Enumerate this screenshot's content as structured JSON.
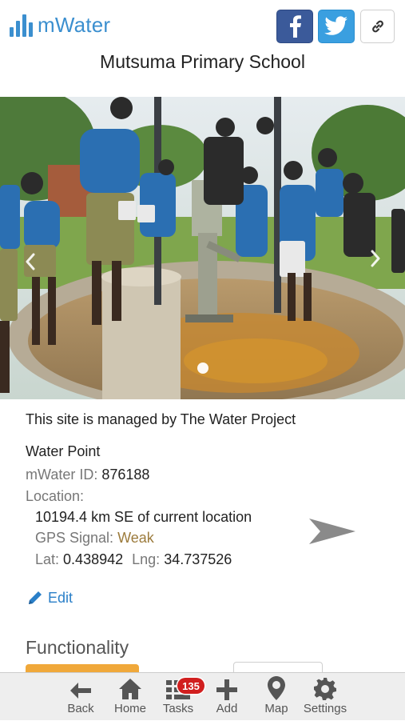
{
  "header": {
    "logo_text": "mWater",
    "share_buttons": [
      {
        "name": "facebook",
        "icon": "facebook-icon"
      },
      {
        "name": "twitter",
        "icon": "twitter-icon"
      },
      {
        "name": "link",
        "icon": "link-icon"
      }
    ],
    "title": "Mutsuma Primary School"
  },
  "photo": {
    "carousel": {
      "prev_icon": "chevron-left-icon",
      "next_icon": "chevron-right-icon",
      "pages": 1,
      "current": 1
    }
  },
  "details": {
    "managed_by": "This site is managed by The Water Project",
    "type": "Water Point",
    "id_label": "mWater ID:",
    "id_value": "876188",
    "location_label": "Location:",
    "distance": "10194.4 km SE of current location",
    "gps_label": "GPS Signal:",
    "gps_value": "Weak",
    "lat_label": "Lat:",
    "lat_value": "0.438942",
    "lng_label": "Lng:",
    "lng_value": "34.737526",
    "edit_label": "Edit",
    "direction_icon": "direction-arrow-icon"
  },
  "functionality": {
    "title": "Functionality"
  },
  "tabbar": {
    "tabs": [
      {
        "label": "Back",
        "icon": "back-arrow-icon"
      },
      {
        "label": "Home",
        "icon": "home-icon"
      },
      {
        "label": "Tasks",
        "icon": "tasks-icon",
        "badge": "135"
      },
      {
        "label": "Add",
        "icon": "plus-icon"
      },
      {
        "label": "Map",
        "icon": "map-pin-icon"
      },
      {
        "label": "Settings",
        "icon": "gear-icon"
      }
    ]
  },
  "colors": {
    "brand": "#3b8fcf",
    "facebook": "#3b5a9a",
    "twitter": "#3a9fe0",
    "link": "#2a7fc8",
    "badge": "#d11f1f",
    "gps_weak": "#9c7b3c",
    "functionality_bar": "#f0a83a"
  }
}
